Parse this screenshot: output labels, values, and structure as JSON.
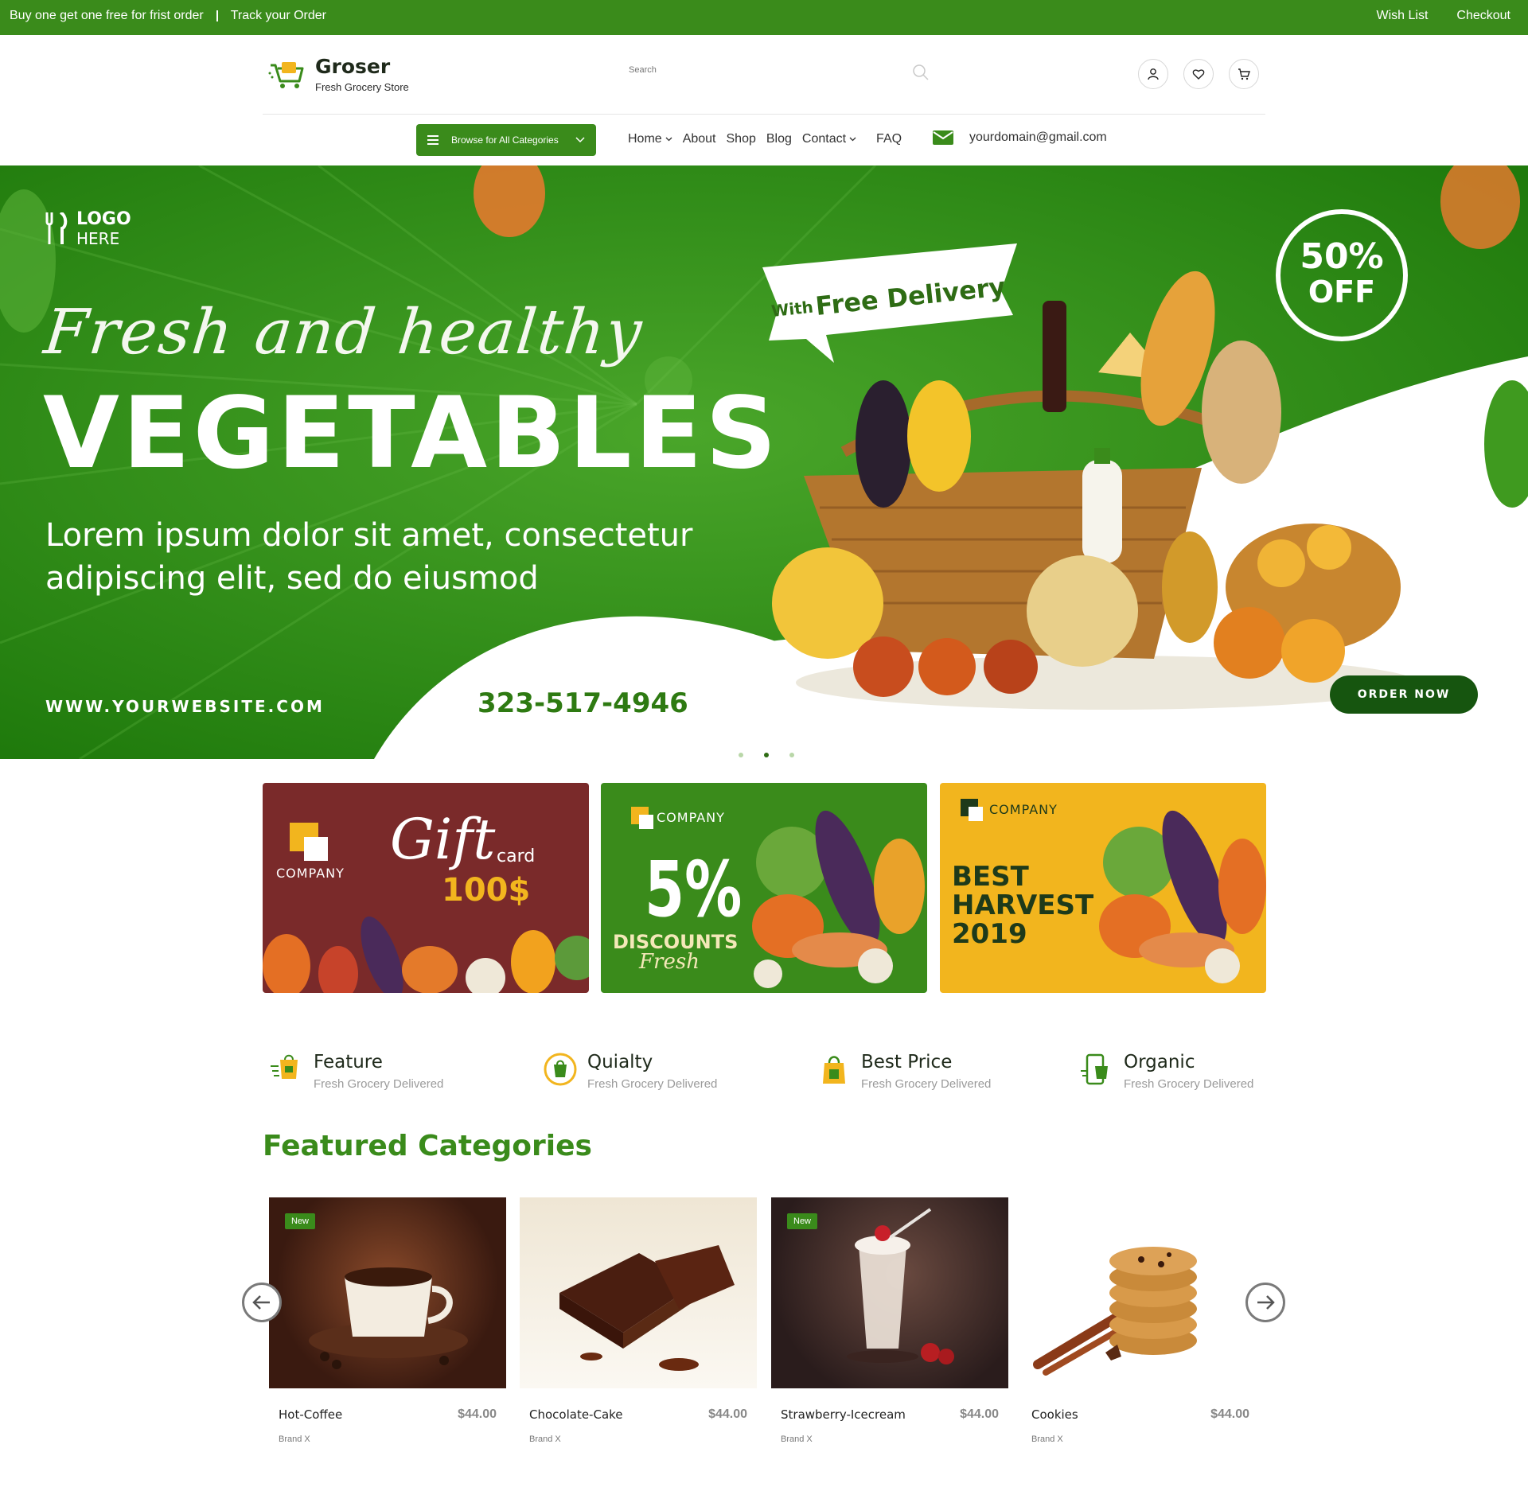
{
  "topbar": {
    "promo": "Buy one get one free for frist order",
    "track": "Track your Order",
    "wishlist": "Wish List",
    "checkout": "Checkout"
  },
  "header": {
    "brand": "Groser",
    "tagline": "Fresh Grocery Store",
    "search_placeholder": "Search"
  },
  "nav": {
    "browse": "Browse for All Categories",
    "items": [
      "Home",
      "About",
      "Shop",
      "Blog",
      "Contact",
      "FAQ"
    ],
    "email": "yourdomain@gmail.com"
  },
  "hero": {
    "logo_top": "LOGO",
    "logo_bottom": "HERE",
    "script": "Fresh and healthy",
    "title": "VEGETABLES",
    "subtitle": "Lorem ipsum dolor sit amet, consectetur adipiscing elit, sed do eiusmod",
    "website": "WWW.YOURWEBSITE.COM",
    "phone": "323-517-4946",
    "ribbon_small": "With",
    "ribbon_big": "Free Delivery",
    "badge_pct": "50%",
    "badge_off": "OFF",
    "order_btn": "ORDER NOW"
  },
  "promos": [
    {
      "company": "COMPANY",
      "line1": "Gift",
      "line2": "card",
      "amount": "100$",
      "bg": "#7a2a2a"
    },
    {
      "company": "COMPANY",
      "big": "5%",
      "line1": "DISCOUNTS",
      "line2": "Fresh",
      "bg": "#3a8b1b"
    },
    {
      "company": "COMPANY",
      "line1": "BEST",
      "line2": "HARVEST",
      "line3": "2019",
      "bg": "#f2b51e"
    }
  ],
  "features": [
    {
      "title": "Feature",
      "sub": "Fresh Grocery Delivered"
    },
    {
      "title": "Quialty",
      "sub": "Fresh Grocery Delivered"
    },
    {
      "title": "Best Price",
      "sub": "Fresh Grocery Delivered"
    },
    {
      "title": "Organic",
      "sub": "Fresh Grocery Delivered"
    }
  ],
  "section_title": "Featured Categories",
  "products": [
    {
      "name": "Hot-Coffee",
      "price": "$44.00",
      "brand": "Brand X",
      "badge": "New"
    },
    {
      "name": "Chocolate-Cake",
      "price": "$44.00",
      "brand": "Brand X",
      "badge": ""
    },
    {
      "name": "Strawberry-Icecream",
      "price": "$44.00",
      "brand": "Brand X",
      "badge": "New"
    },
    {
      "name": "Cookies",
      "price": "$44.00",
      "brand": "Brand X",
      "badge": ""
    }
  ],
  "colors": {
    "brand_green": "#3a8b1b",
    "dark_green": "#16550f",
    "maroon": "#7a2a2a",
    "yellow": "#f2b51e"
  }
}
